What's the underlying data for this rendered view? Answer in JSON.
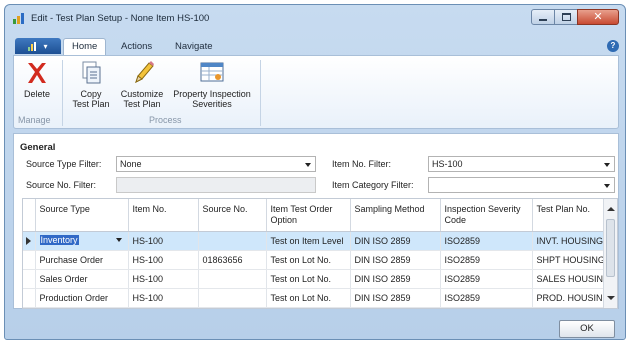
{
  "window": {
    "title": "Edit - Test Plan Setup - None  Item HS-100",
    "caption_buttons": [
      "minimize",
      "maximize",
      "close"
    ]
  },
  "ribbon": {
    "tabs": [
      {
        "label": "Home",
        "active": true
      },
      {
        "label": "Actions",
        "active": false
      },
      {
        "label": "Navigate",
        "active": false
      }
    ],
    "groups": {
      "manage": "Manage",
      "process": "Process"
    },
    "buttons": {
      "delete": "Delete",
      "copy_test_plan_1": "Copy",
      "copy_test_plan_2": "Test Plan",
      "customize_1": "Customize",
      "customize_2": "Test Plan",
      "property_1": "Property Inspection",
      "property_2": "Severities"
    },
    "icons": [
      "delete-x-icon",
      "copy-icon",
      "pencil-icon",
      "inspection-grid-icon",
      "help-icon"
    ]
  },
  "general": {
    "section_title": "General",
    "source_type_filter": {
      "label": "Source Type Filter:",
      "value": "None"
    },
    "source_no_filter": {
      "label": "Source No. Filter:",
      "value": ""
    },
    "item_no_filter": {
      "label": "Item No. Filter:",
      "value": "HS-100"
    },
    "item_category_filter": {
      "label": "Item Category Filter:",
      "value": ""
    }
  },
  "grid": {
    "columns": {
      "source_type": "Source Type",
      "item_no": "Item No.",
      "source_no": "Source No.",
      "item_test_order_option_1": "Item Test Order",
      "item_test_order_option_2": "Option",
      "sampling_method": "Sampling Method",
      "inspection_severity_code_1": "Inspection Severity",
      "inspection_severity_code_2": "Code",
      "test_plan_no": "Test Plan No."
    },
    "rows": [
      {
        "source_type": "Inventory",
        "item_no": "HS-100",
        "source_no": "",
        "item_test_order_option": "Test on Item Level",
        "sampling_method": "DIN ISO 2859",
        "inspection_severity_code": "ISO2859",
        "test_plan_no": "INVT. HOUSING"
      },
      {
        "source_type": "Purchase Order",
        "item_no": "HS-100",
        "source_no": "01863656",
        "item_test_order_option": "Test on Lot No.",
        "sampling_method": "DIN ISO 2859",
        "inspection_severity_code": "ISO2859",
        "test_plan_no": "SHPT HOUSING"
      },
      {
        "source_type": "Sales Order",
        "item_no": "HS-100",
        "source_no": "",
        "item_test_order_option": "Test on Lot No.",
        "sampling_method": "DIN ISO 2859",
        "inspection_severity_code": "ISO2859",
        "test_plan_no": "SALES HOUSING"
      },
      {
        "source_type": "Production Order",
        "item_no": "HS-100",
        "source_no": "",
        "item_test_order_option": "Test on Lot No.",
        "sampling_method": "DIN ISO 2859",
        "inspection_severity_code": "ISO2859",
        "test_plan_no": "PROD. HOUSING"
      }
    ]
  },
  "footer": {
    "ok_label": "OK"
  }
}
